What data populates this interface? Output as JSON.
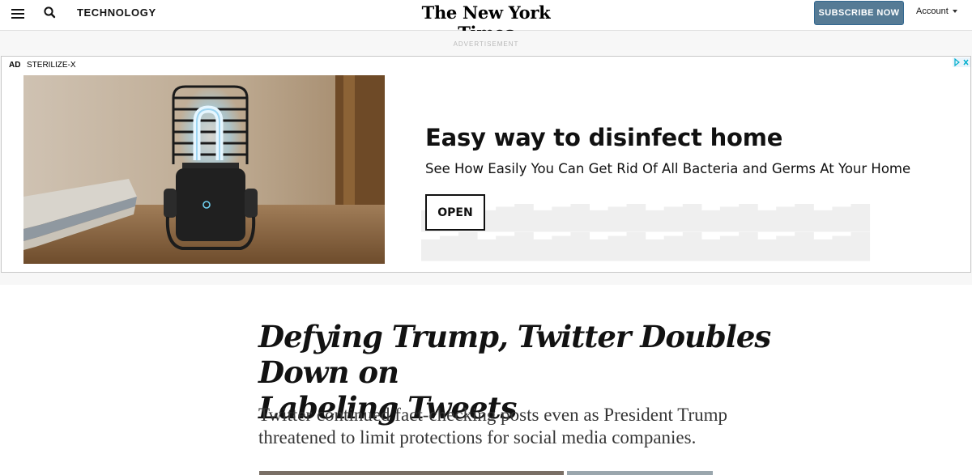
{
  "header": {
    "section": "TECHNOLOGY",
    "masthead": "The New York Times",
    "subscribe_label": "SUBSCRIBE NOW",
    "account_label": "Account",
    "icons": {
      "menu": "hamburger-menu-icon",
      "search": "search-icon",
      "account_caret": "chevron-down-icon"
    }
  },
  "ad": {
    "label": "ADVERTISEMENT",
    "tag": "AD",
    "brand": "STERILIZE-X",
    "headline": "Easy way to disinfect home",
    "subheadline": "See How Easily You Can Get Rid Of All Bacteria and Germs At Your Home",
    "cta": "OPEN",
    "image_subject": "uv-sterilizer-lamp-on-wooden-table"
  },
  "article": {
    "headline_line1": "Defying Trump, Twitter Doubles Down on",
    "headline_line2": "Labeling Tweets",
    "summary_line1": "Twitter continued fact-checking posts even as President Trump",
    "summary_line2": "threatened to limit protections for social media companies."
  },
  "colors": {
    "subscribe_bg": "#567b95",
    "ad_band_bg": "#f7f7f7",
    "text": "#121212",
    "summary_text": "#363636"
  }
}
